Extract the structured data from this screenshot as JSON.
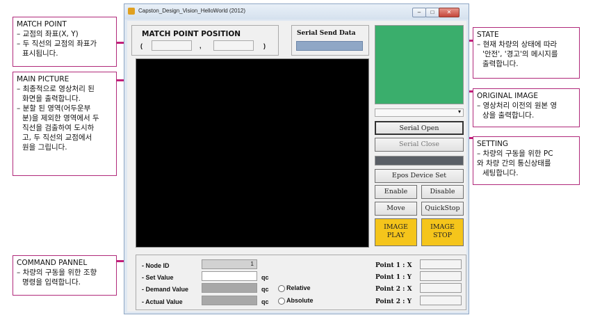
{
  "window": {
    "title": "Capston_Design_Vision_HelloWorld (2012)",
    "controls": {
      "minimize": "–",
      "maximize": "□",
      "close": "✕"
    }
  },
  "match_point": {
    "heading": "MATCH POINT POSITION",
    "open_paren": "(",
    "comma": ",",
    "close_paren": ")",
    "x_value": "",
    "y_value": ""
  },
  "serial_send": {
    "heading": "Serial Send Data",
    "value": ""
  },
  "colors": {
    "state_panel": "#3aae6c",
    "main_picture": "#000000",
    "image_button": "#f5c51b",
    "accent_annotation": "#c21f7a"
  },
  "buttons": {
    "serial_open": "Serial Open",
    "serial_close": "Serial Close",
    "epos_device_set": "Epos Device Set",
    "enable": "Enable",
    "disable": "Disable",
    "move": "Move",
    "quickstop": "QuickStop",
    "image_play": [
      "IMAGE",
      "PLAY"
    ],
    "image_stop": [
      "IMAGE",
      "STOP"
    ]
  },
  "command": {
    "node_id_label": "- Node ID",
    "node_id_value": "1",
    "set_value_label": "- Set Value",
    "demand_value_label": "- Demand Value",
    "actual_value_label": "- Actual Value",
    "unit": "qc",
    "relative_label": "Relative",
    "absolute_label": "Absolute",
    "point1x_label": "Point 1 : X",
    "point1y_label": "Point 1 : Y",
    "point2x_label": "Point 2 : X",
    "point2y_label": "Point 2 : Y"
  },
  "annotations": {
    "match_point": [
      "MATCH POINT",
      "– 교점의 좌표(X, Y)",
      "– 두 직선의 교점의 좌표가",
      "  표시됩니다."
    ],
    "main_picture": [
      "MAIN PICTURE",
      "– 최종적으로 영상처리 된",
      "  화면을 출력합니다.",
      "– 분할 된 영역(어두운부",
      "  분)을 제외한 영역에서 두",
      "  직선을 검출하여 도시하",
      "  고, 두 직선의 교점에서",
      "  원을 그립니다."
    ],
    "command_pannel": [
      "COMMAND PANNEL",
      "– 차량의 구동을 위한 조향",
      "  명령을 입력합니다."
    ],
    "state": [
      "STATE",
      "– 현재 차량의 상태에 따라",
      "  '안전', '경고'의 메시지를",
      "  출력합니다."
    ],
    "original_image": [
      "ORIGINAL IMAGE",
      "– 영상처리 이전의 원본 영",
      "  상을 출력합니다."
    ],
    "setting": [
      "SETTING",
      "– 차량의 구동을 위한 PC",
      "와 차량 간의 통신상태를",
      "  세팅합니다."
    ]
  }
}
